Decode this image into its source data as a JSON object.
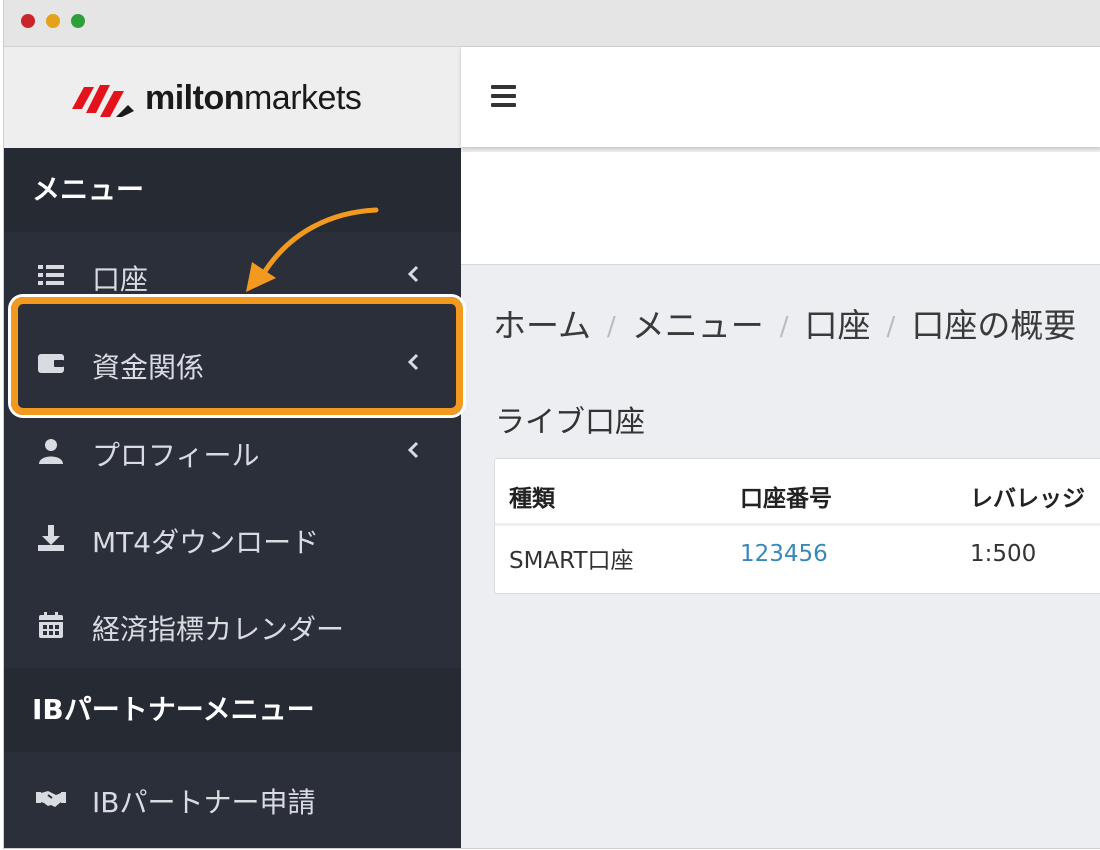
{
  "brand": {
    "name_bold": "milton",
    "name_regular": "markets",
    "colors": {
      "logo_red": "#e3131b",
      "accent_orange": "#f29a1f",
      "sidebar_bg": "#2a2f3a",
      "link_blue": "#3a88b8"
    }
  },
  "topbar": {
    "menu_icon": "hamburger-icon"
  },
  "sidebar": {
    "menu_heading": "メニュー",
    "items": [
      {
        "label": "口座",
        "icon": "list-icon",
        "has_submenu": true
      },
      {
        "label": "資金関係",
        "icon": "wallet-icon",
        "has_submenu": true,
        "highlighted": true
      },
      {
        "label": "プロフィール",
        "icon": "user-icon",
        "has_submenu": true
      },
      {
        "label": "MT4ダウンロード",
        "icon": "download-icon",
        "has_submenu": false
      },
      {
        "label": "経済指標カレンダー",
        "icon": "calendar-icon",
        "has_submenu": false
      }
    ],
    "ib_heading": "IBパートナーメニュー",
    "ib_items": [
      {
        "label": "IBパートナー申請",
        "icon": "handshake-icon"
      }
    ]
  },
  "breadcrumb": {
    "items": [
      "ホーム",
      "メニュー",
      "口座",
      "口座の概要"
    ],
    "separator": "/"
  },
  "section": {
    "title": "ライブ口座"
  },
  "accounts_table": {
    "headers": [
      "種類",
      "口座番号",
      "レバレッジ"
    ],
    "rows": [
      [
        "SMART口座",
        "123456",
        "1:500"
      ]
    ]
  }
}
